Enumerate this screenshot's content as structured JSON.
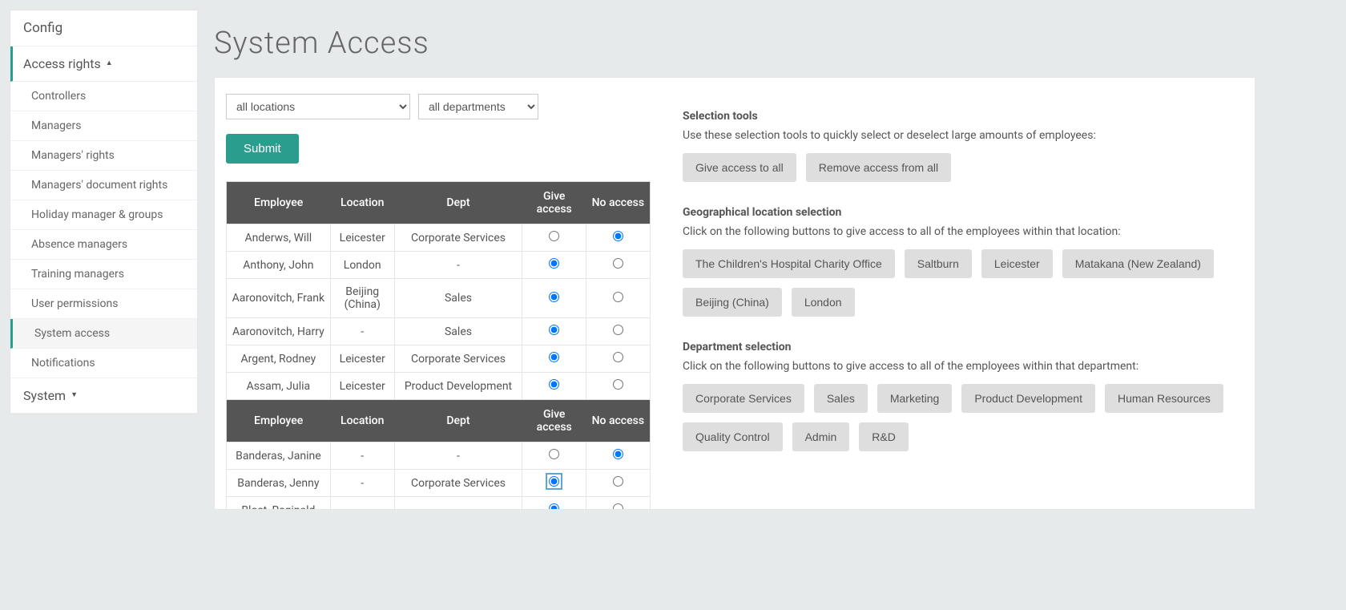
{
  "sidebar": {
    "header": "Config",
    "section_access": "Access rights",
    "section_system": "System",
    "items": [
      "Controllers",
      "Managers",
      "Managers' rights",
      "Managers' document rights",
      "Holiday manager & groups",
      "Absence managers",
      "Training managers",
      "User permissions",
      "System access",
      "Notifications"
    ]
  },
  "page": {
    "title": "System Access"
  },
  "filters": {
    "location": "all locations",
    "department": "all departments",
    "submit": "Submit"
  },
  "table": {
    "headers": {
      "employee": "Employee",
      "location": "Location",
      "dept": "Dept",
      "give": "Give access",
      "no": "No access"
    },
    "group1": [
      {
        "name": "Anderws, Will",
        "location": "Leicester",
        "dept": "Corporate Services",
        "access": "no"
      },
      {
        "name": "Anthony, John",
        "location": "London",
        "dept": "-",
        "access": "give"
      },
      {
        "name": "Aaronovitch, Frank",
        "location": "Beijing (China)",
        "dept": "Sales",
        "access": "give"
      },
      {
        "name": "Aaronovitch, Harry",
        "location": "-",
        "dept": "Sales",
        "access": "give"
      },
      {
        "name": "Argent, Rodney",
        "location": "Leicester",
        "dept": "Corporate Services",
        "access": "give"
      },
      {
        "name": "Assam, Julia",
        "location": "Leicester",
        "dept": "Product Development",
        "access": "give"
      }
    ],
    "group2": [
      {
        "name": "Banderas, Janine",
        "location": "-",
        "dept": "-",
        "access": "no"
      },
      {
        "name": "Banderas, Jenny",
        "location": "-",
        "dept": "Corporate Services",
        "access": "give",
        "focused": true
      },
      {
        "name": "Blost, Reginald",
        "location": "-",
        "dept": "-",
        "access": "give"
      }
    ]
  },
  "tools": {
    "selection": {
      "title": "Selection tools",
      "desc": "Use these selection tools to quickly select or deselect large amounts of employees:",
      "give_all": "Give access to all",
      "remove_all": "Remove access from all"
    },
    "geo": {
      "title": "Geographical location selection",
      "desc": "Click on the following buttons to give access to all of the employees within that location:",
      "buttons": [
        "The Children's Hospital Charity Office",
        "Saltburn",
        "Leicester",
        "Matakana (New Zealand)",
        "Beijing (China)",
        "London"
      ]
    },
    "dept": {
      "title": "Department selection",
      "desc": "Click on the following buttons to give access to all of the employees within that department:",
      "buttons": [
        "Corporate Services",
        "Sales",
        "Marketing",
        "Product Development",
        "Human Resources",
        "Quality Control",
        "Admin",
        "R&D"
      ]
    }
  }
}
